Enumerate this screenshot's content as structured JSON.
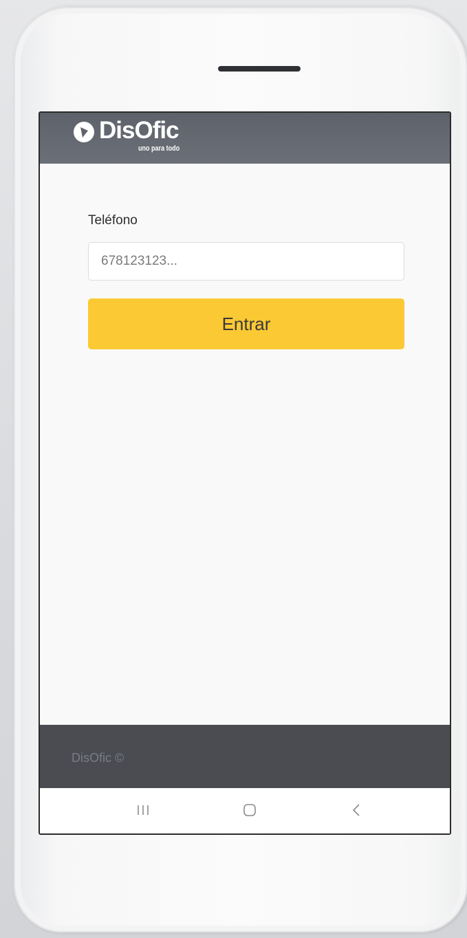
{
  "app": {
    "brand_name": "DisOfic",
    "tagline": "uno para todo"
  },
  "login": {
    "phone_label": "Teléfono",
    "phone_placeholder": "678123123...",
    "phone_value": "",
    "submit_label": "Entrar"
  },
  "footer": {
    "text": "DisOfic ©"
  },
  "system_nav": {
    "recents_icon": "recents-icon",
    "home_icon": "home-icon",
    "back_icon": "back-icon"
  },
  "colors": {
    "header_bg": "#666a72",
    "accent_button": "#fbc933",
    "footer_bg": "#4a4c52",
    "screen_bg": "#f9f9f9"
  }
}
